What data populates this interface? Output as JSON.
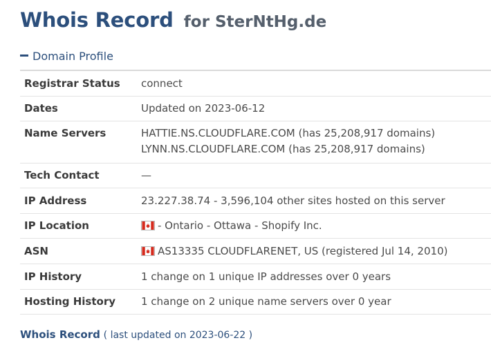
{
  "header": {
    "title": "Whois Record",
    "for_text": "for SterNtHg.de"
  },
  "section": {
    "label": "Domain Profile",
    "toggle_icon": "minus-icon"
  },
  "profile": {
    "registrar_status": {
      "label": "Registrar Status",
      "value": "connect"
    },
    "dates": {
      "label": "Dates",
      "value": "Updated on 2023-06-12"
    },
    "name_servers": {
      "label": "Name Servers",
      "values": [
        "HATTIE.NS.CLOUDFLARE.COM (has 25,208,917 domains)",
        "LYNN.NS.CLOUDFLARE.COM (has 25,208,917 domains)"
      ]
    },
    "tech_contact": {
      "label": "Tech Contact",
      "value": "—"
    },
    "ip_address": {
      "label": "IP Address",
      "value": "23.227.38.74 - 3,596,104 other sites hosted on this server"
    },
    "ip_location": {
      "label": "IP Location",
      "value": "- Ontario - Ottawa - Shopify Inc.",
      "flag_icon": "canada-flag-icon"
    },
    "asn": {
      "label": "ASN",
      "value": "AS13335 CLOUDFLARENET, US (registered Jul 14, 2010)",
      "flag_icon": "canada-flag-icon"
    },
    "ip_history": {
      "label": "IP History",
      "value": "1 change on 1 unique IP addresses over 0 years"
    },
    "hosting_history": {
      "label": "Hosting History",
      "value": "1 change on 2 unique name servers over 0 year"
    }
  },
  "footer": {
    "title": "Whois Record",
    "subtitle": "( last updated on 2023-06-22 )"
  },
  "colors": {
    "accent": "#2c4f7c",
    "flag_red": "#d52b1e"
  }
}
